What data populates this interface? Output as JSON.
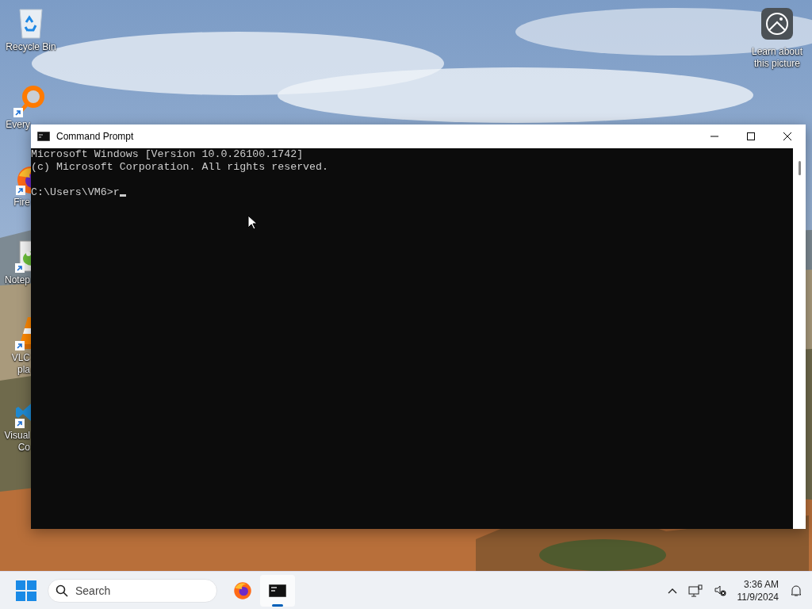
{
  "desktop_icons": [
    {
      "kind": "recycle-bin",
      "lines": [
        "Recycle Bin"
      ],
      "shortcut": false
    },
    {
      "kind": "search-app",
      "lines": [
        "Every"
      ],
      "shortcut": true
    },
    {
      "kind": "browser",
      "lines": [
        "Fire"
      ],
      "shortcut": true
    },
    {
      "kind": "notepad",
      "lines": [
        "Notep"
      ],
      "shortcut": true
    },
    {
      "kind": "cone",
      "lines": [
        "VLC",
        "pla"
      ],
      "shortcut": true
    },
    {
      "kind": "code-editor",
      "lines": [
        "Visual",
        "Co"
      ],
      "shortcut": true
    }
  ],
  "picture_info": {
    "label": "Learn about this picture"
  },
  "window": {
    "title": "Command Prompt",
    "console_text": "Microsoft Windows [Version 10.0.26100.1742]\n(c) Microsoft Corporation. All rights reserved.\n\nC:\\Users\\VM6>r"
  },
  "taskbar": {
    "search": {
      "placeholder": "Search"
    },
    "apps": [
      {
        "kind": "browser",
        "open": false
      },
      {
        "kind": "terminal",
        "open": true
      }
    ],
    "clock": {
      "time": "3:36 AM",
      "date": "11/9/2024"
    }
  }
}
